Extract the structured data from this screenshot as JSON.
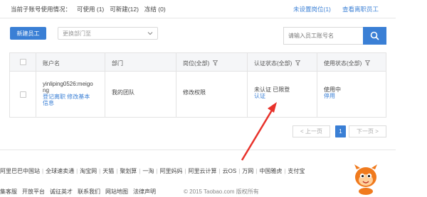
{
  "stats": {
    "label": "当前子账号使用情况：",
    "usable": "可使用 (1)",
    "creatable": "可新建(12)",
    "frozen": "冻结 (0)"
  },
  "links": {
    "unassigned": "未设置岗位(1)",
    "resigned": "查看离职员工"
  },
  "toolbar": {
    "new_employee": "新建员工",
    "dept_select_placeholder": "更换部门至",
    "search_placeholder": "请输入员工账号名"
  },
  "table": {
    "headers": {
      "account": "账户名",
      "department": "部门",
      "position": "岗位(全部)",
      "auth_status": "认证状态(全部)",
      "use_status": "使用状态(全部)"
    },
    "row": {
      "account_line1": "yinliping0526:meigo",
      "account_line2": "ng",
      "action_resign": "登记离职",
      "action_edit": "修改基本",
      "action_info": "信息",
      "department": "我的团队",
      "position_action": "修改权限",
      "auth_status": "未认证 已限登",
      "auth_action": "认证",
      "use_status": "使用中",
      "use_action": "停用"
    }
  },
  "pagination": {
    "prev": "< 上一页",
    "current": "1",
    "next": "下一页 >"
  },
  "footer": {
    "links": [
      "阿里巴巴中国站",
      "全球速卖通",
      "淘宝网",
      "天猫",
      "聚划算",
      "一淘",
      "阿里妈妈",
      "阿里云计算",
      "云OS",
      "万网",
      "中国雅虎",
      "支付宝"
    ],
    "links2": [
      "集客服",
      "开放平台",
      "诚征英才",
      "联系我们",
      "网站地图",
      "法律声明"
    ],
    "copyright": "© 2015 Taobao.com 版权所有"
  },
  "colors": {
    "accent": "#3a7fd5",
    "arrow": "#e8322b"
  }
}
